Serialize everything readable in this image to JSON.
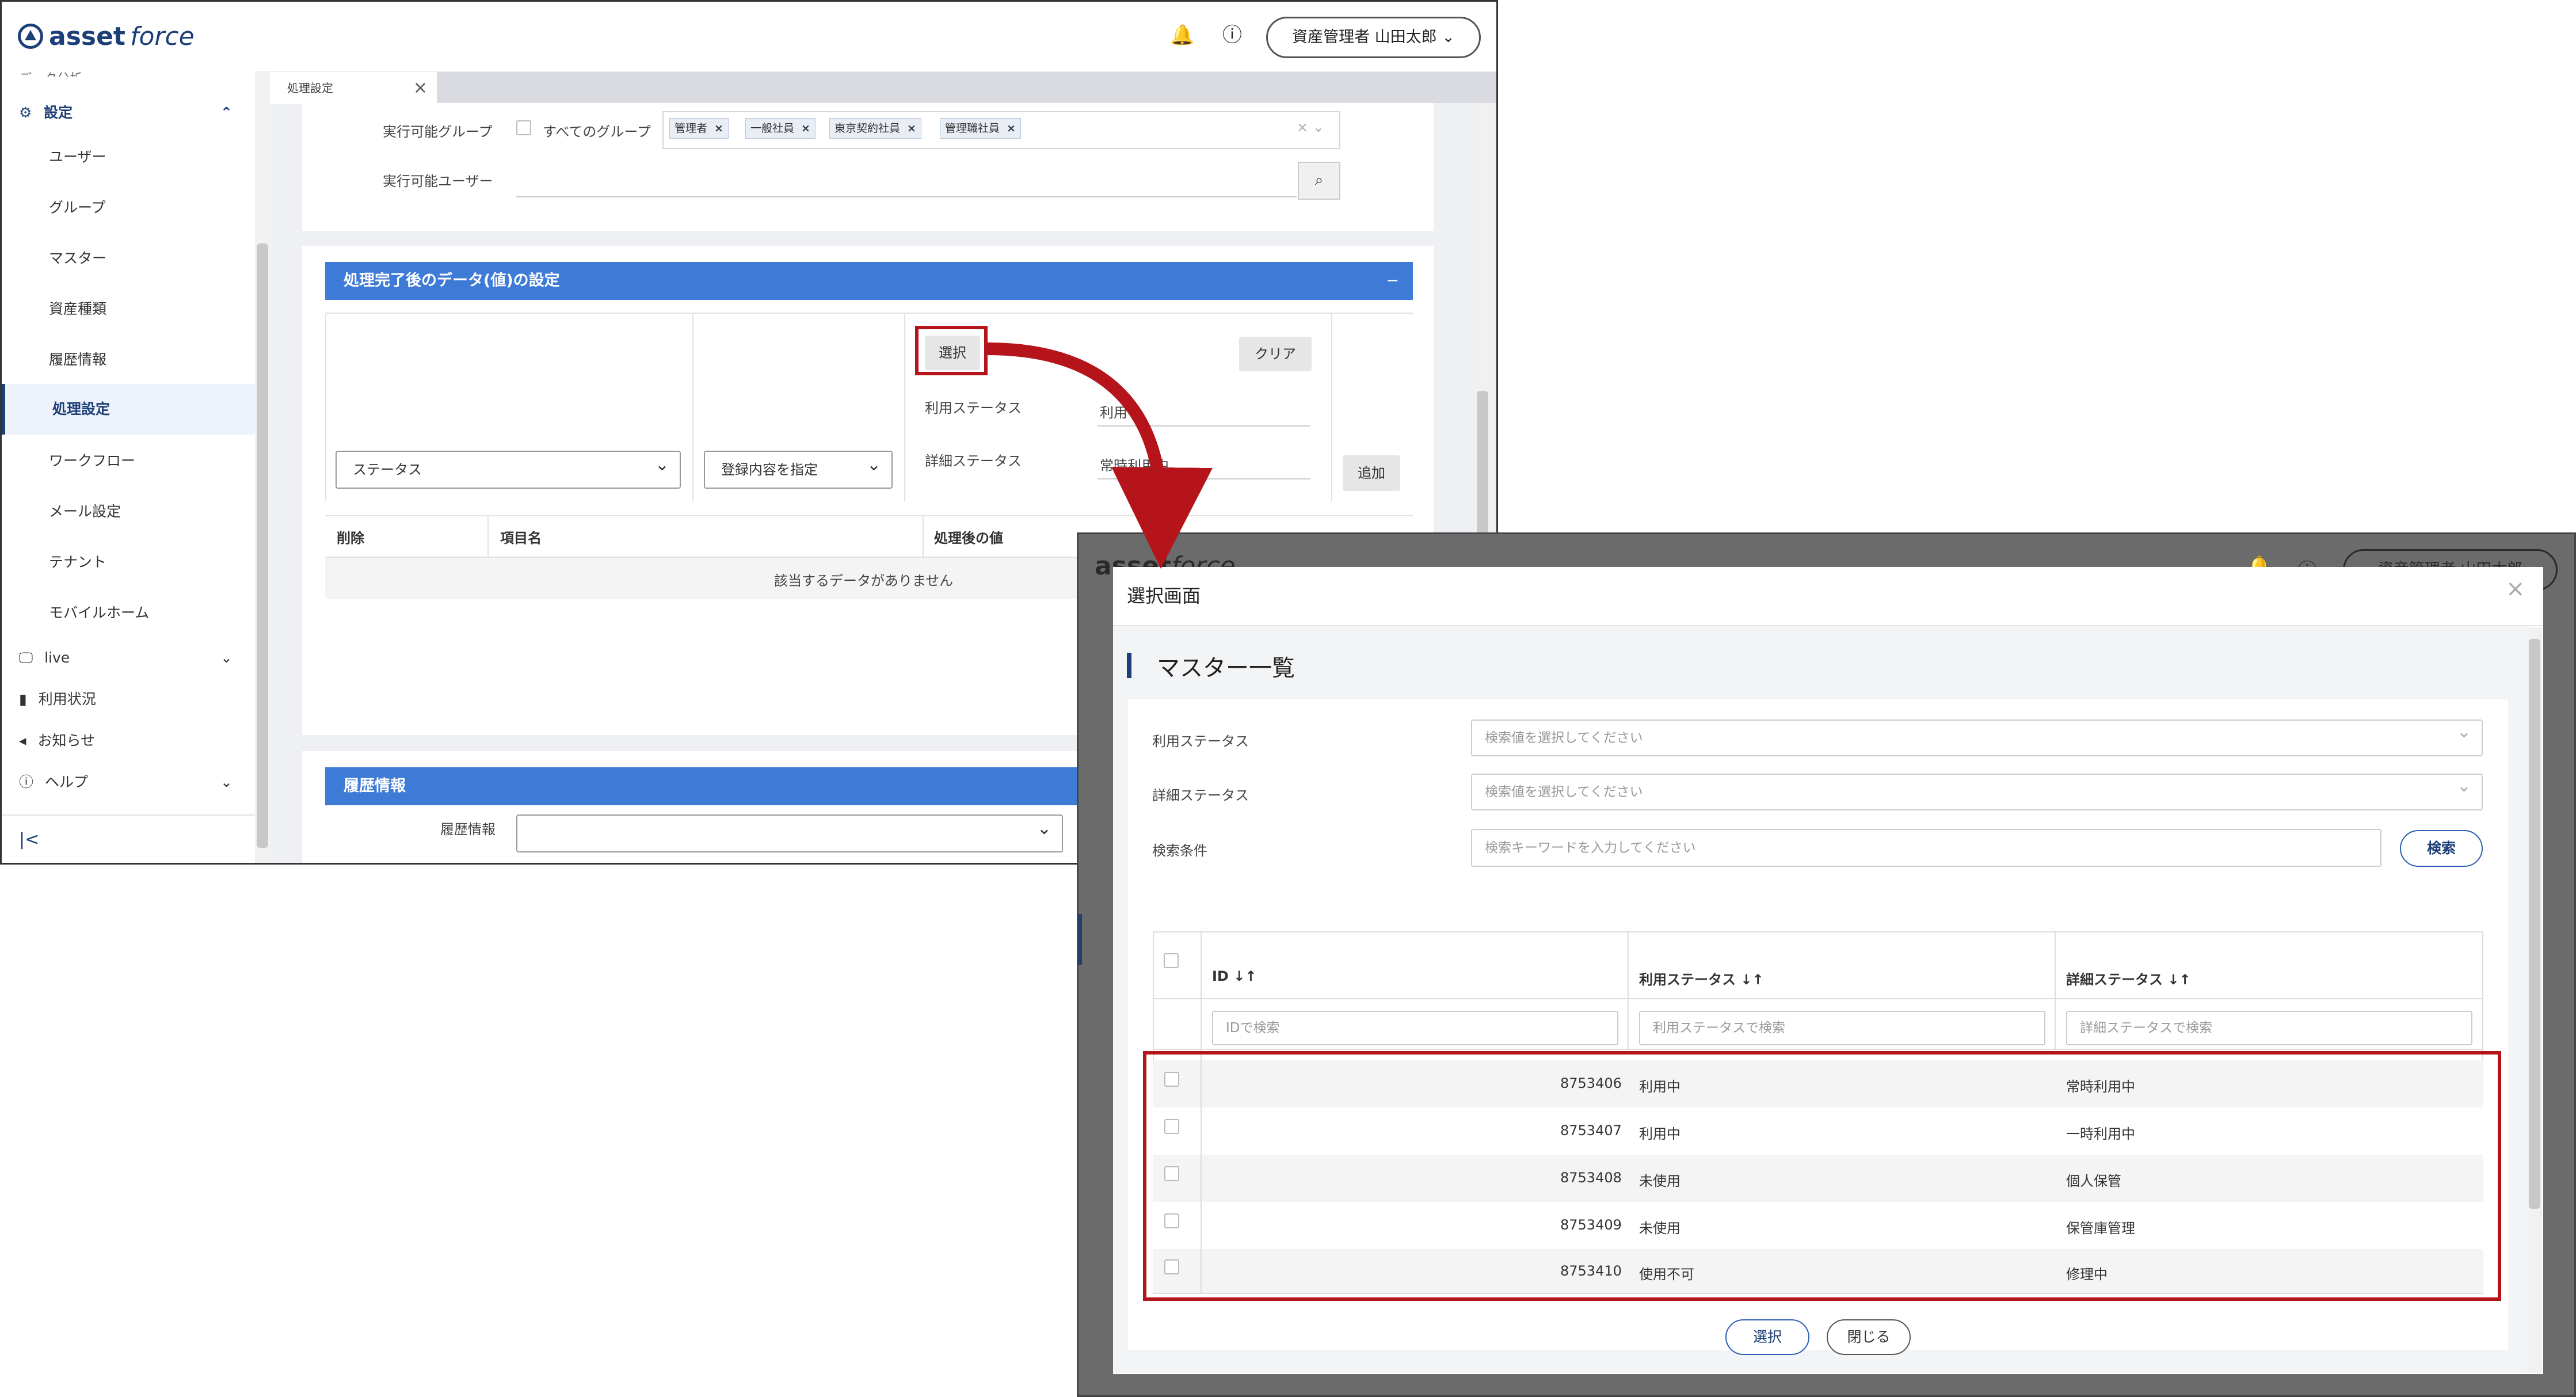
{
  "app": {
    "brand_strong": "asset",
    "brand_light": "force",
    "user_label": "資産管理者 山田太郎"
  },
  "sidebar": {
    "cut_item": "データ分析",
    "settings_label": "設定",
    "items": [
      "ユーザー",
      "グループ",
      "マスター",
      "資産種類",
      "履歴情報",
      "処理設定",
      "ワークフロー",
      "メール設定",
      "テナント",
      "モバイルホーム"
    ],
    "active_index": 5,
    "sections": [
      "live",
      "利用状況",
      "お知らせ",
      "ヘルプ"
    ],
    "collapse_icon": "|<"
  },
  "tab": {
    "label": "処理設定",
    "close": "×"
  },
  "permissions": {
    "group_label": "実行可能グループ",
    "all_groups_label": "すべてのグループ",
    "tags": [
      "管理者",
      "一般社員",
      "東京契約社員",
      "管理職社員"
    ],
    "user_label": "実行可能ユーザー"
  },
  "after_section": {
    "title": "処理完了後のデータ(値)の設定",
    "collapse": "−",
    "select_button": "選択",
    "clear_button": "クリア",
    "status_label": "利用ステータス",
    "status_value": "利用中",
    "detail_label": "詳細ステータス",
    "detail_value": "常時利用中",
    "select_item": "ステータス",
    "select_mode": "登録内容を指定",
    "add_button": "追加",
    "col_delete": "削除",
    "col_item": "項目名",
    "col_value": "処理後の値",
    "empty": "該当するデータがありません"
  },
  "history_section": {
    "title": "履歴情報",
    "label": "履歴情報"
  },
  "background2": {
    "user_label": "資産管理者 山田太郎"
  },
  "modal": {
    "title": "選択画面",
    "close": "×",
    "subtitle": "マスター一覧",
    "filters": [
      {
        "label": "利用ステータス",
        "placeholder": "検索値を選択してください"
      },
      {
        "label": "詳細ステータス",
        "placeholder": "検索値を選択してください"
      },
      {
        "label": "検索条件",
        "placeholder": "検索キーワードを入力してください"
      }
    ],
    "search_button": "検索",
    "columns": [
      {
        "label": "ID",
        "filter": "IDで検索"
      },
      {
        "label": "利用ステータス",
        "filter": "利用ステータスで検索"
      },
      {
        "label": "詳細ステータス",
        "filter": "詳細ステータスで検索"
      }
    ],
    "sort_icon": "↓↑",
    "rows": [
      {
        "id": "8753406",
        "status": "利用中",
        "detail": "常時利用中"
      },
      {
        "id": "8753407",
        "status": "利用中",
        "detail": "一時利用中"
      },
      {
        "id": "8753408",
        "status": "未使用",
        "detail": "個人保管"
      },
      {
        "id": "8753409",
        "status": "未使用",
        "detail": "保管庫管理"
      },
      {
        "id": "8753410",
        "status": "使用不可",
        "detail": "修理中"
      }
    ],
    "select_button": "選択",
    "close_button": "閉じる"
  },
  "colors": {
    "brand": "#1d3f78",
    "section_bar": "#3e7bd6",
    "highlight": "#b5141b"
  }
}
